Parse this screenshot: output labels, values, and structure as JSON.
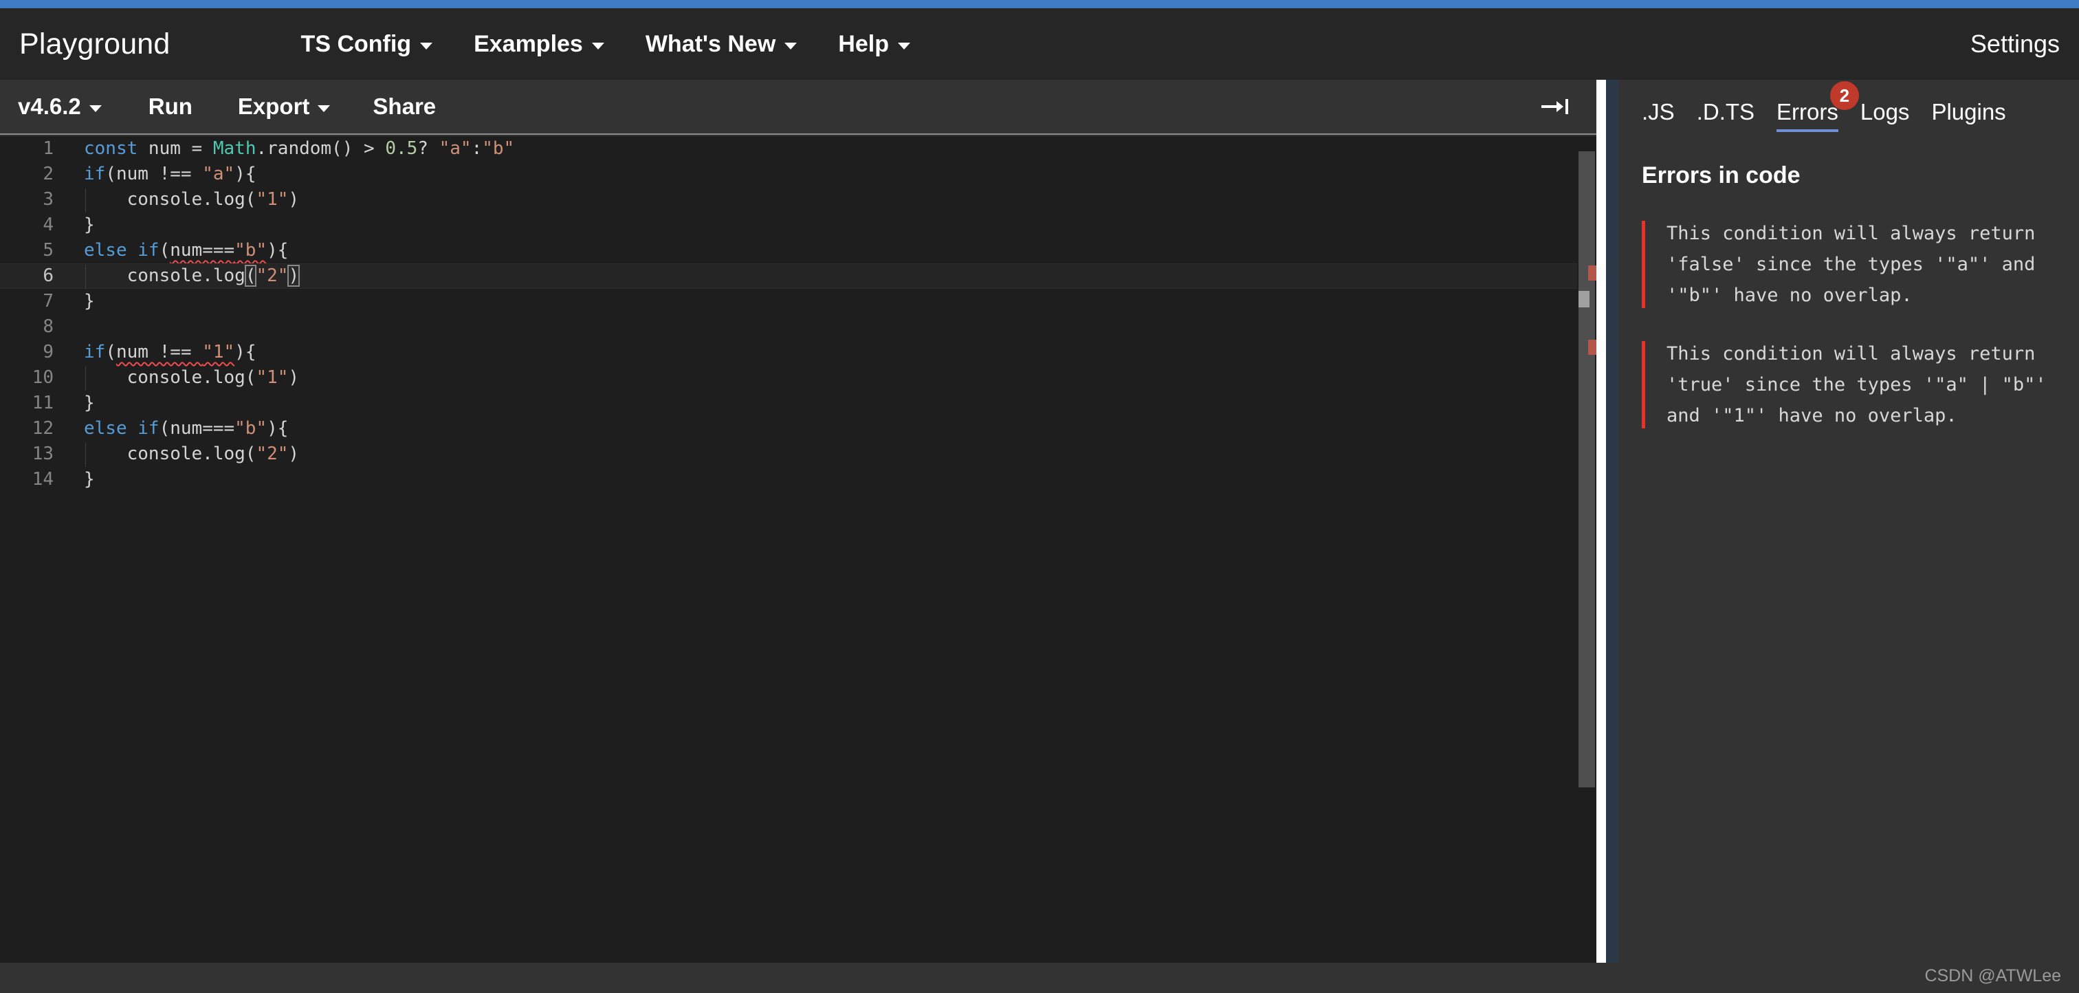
{
  "header": {
    "brand": "Playground",
    "nav": [
      {
        "label": "TS Config",
        "has_caret": true
      },
      {
        "label": "Examples",
        "has_caret": true
      },
      {
        "label": "What's New",
        "has_caret": true
      },
      {
        "label": "Help",
        "has_caret": true
      }
    ],
    "settings_label": "Settings",
    "accent_top_bar_color": "#3e7dc4",
    "background_color": "#262626"
  },
  "toolbar": {
    "version_label": "v4.6.2",
    "run_label": "Run",
    "export_label": "Export",
    "share_label": "Share",
    "collapse_icon": "arrow-to-bar-icon"
  },
  "editor": {
    "language": "typescript",
    "active_line": 6,
    "cursor": {
      "line": 6,
      "column": 21
    },
    "background_color": "#1e1e1e",
    "token_colors": {
      "keyword": "#569cd6",
      "class": "#4ec9b0",
      "string": "#ce9178",
      "number": "#b5cea8",
      "plain": "#d4d4d4",
      "line_number": "#858585",
      "error_squiggle": "#f14c4c"
    },
    "lines": [
      {
        "n": 1,
        "text": "const num = Math.random() > 0.5? \"a\":\"b\""
      },
      {
        "n": 2,
        "text": "if(num !== \"a\"){"
      },
      {
        "n": 3,
        "text": "    console.log(\"1\")"
      },
      {
        "n": 4,
        "text": "}"
      },
      {
        "n": 5,
        "text": "else if(num===\"b\"){"
      },
      {
        "n": 6,
        "text": "    console.log(\"2\")"
      },
      {
        "n": 7,
        "text": "}"
      },
      {
        "n": 8,
        "text": ""
      },
      {
        "n": 9,
        "text": "if(num !== \"1\"){"
      },
      {
        "n": 10,
        "text": "    console.log(\"1\")"
      },
      {
        "n": 11,
        "text": "}"
      },
      {
        "n": 12,
        "text": "else if(num===\"b\"){"
      },
      {
        "n": 13,
        "text": "    console.log(\"2\")"
      },
      {
        "n": 14,
        "text": "}"
      }
    ],
    "error_lines": [
      5,
      9
    ]
  },
  "sidebar": {
    "tabs": [
      {
        "label": ".JS",
        "active": false,
        "badge": null
      },
      {
        "label": ".D.TS",
        "active": false,
        "badge": null
      },
      {
        "label": "Errors",
        "active": true,
        "badge": "2"
      },
      {
        "label": "Logs",
        "active": false,
        "badge": null
      },
      {
        "label": "Plugins",
        "active": false,
        "badge": null
      }
    ],
    "panel_title": "Errors in code",
    "errors": [
      {
        "message": "This condition will always return\n'false' since the types '\"a\"' and\n'\"b\"' have no overlap."
      },
      {
        "message": "This condition will always return\n'true' since the types '\"a\" | \"b\"'\nand '\"1\"' have no overlap."
      }
    ],
    "error_marker_color": "#e8312a",
    "badge_color": "#c0392b",
    "active_tab_underline_color": "#6f8fd4"
  },
  "footer": {
    "watermark": "CSDN @ATWLee"
  }
}
